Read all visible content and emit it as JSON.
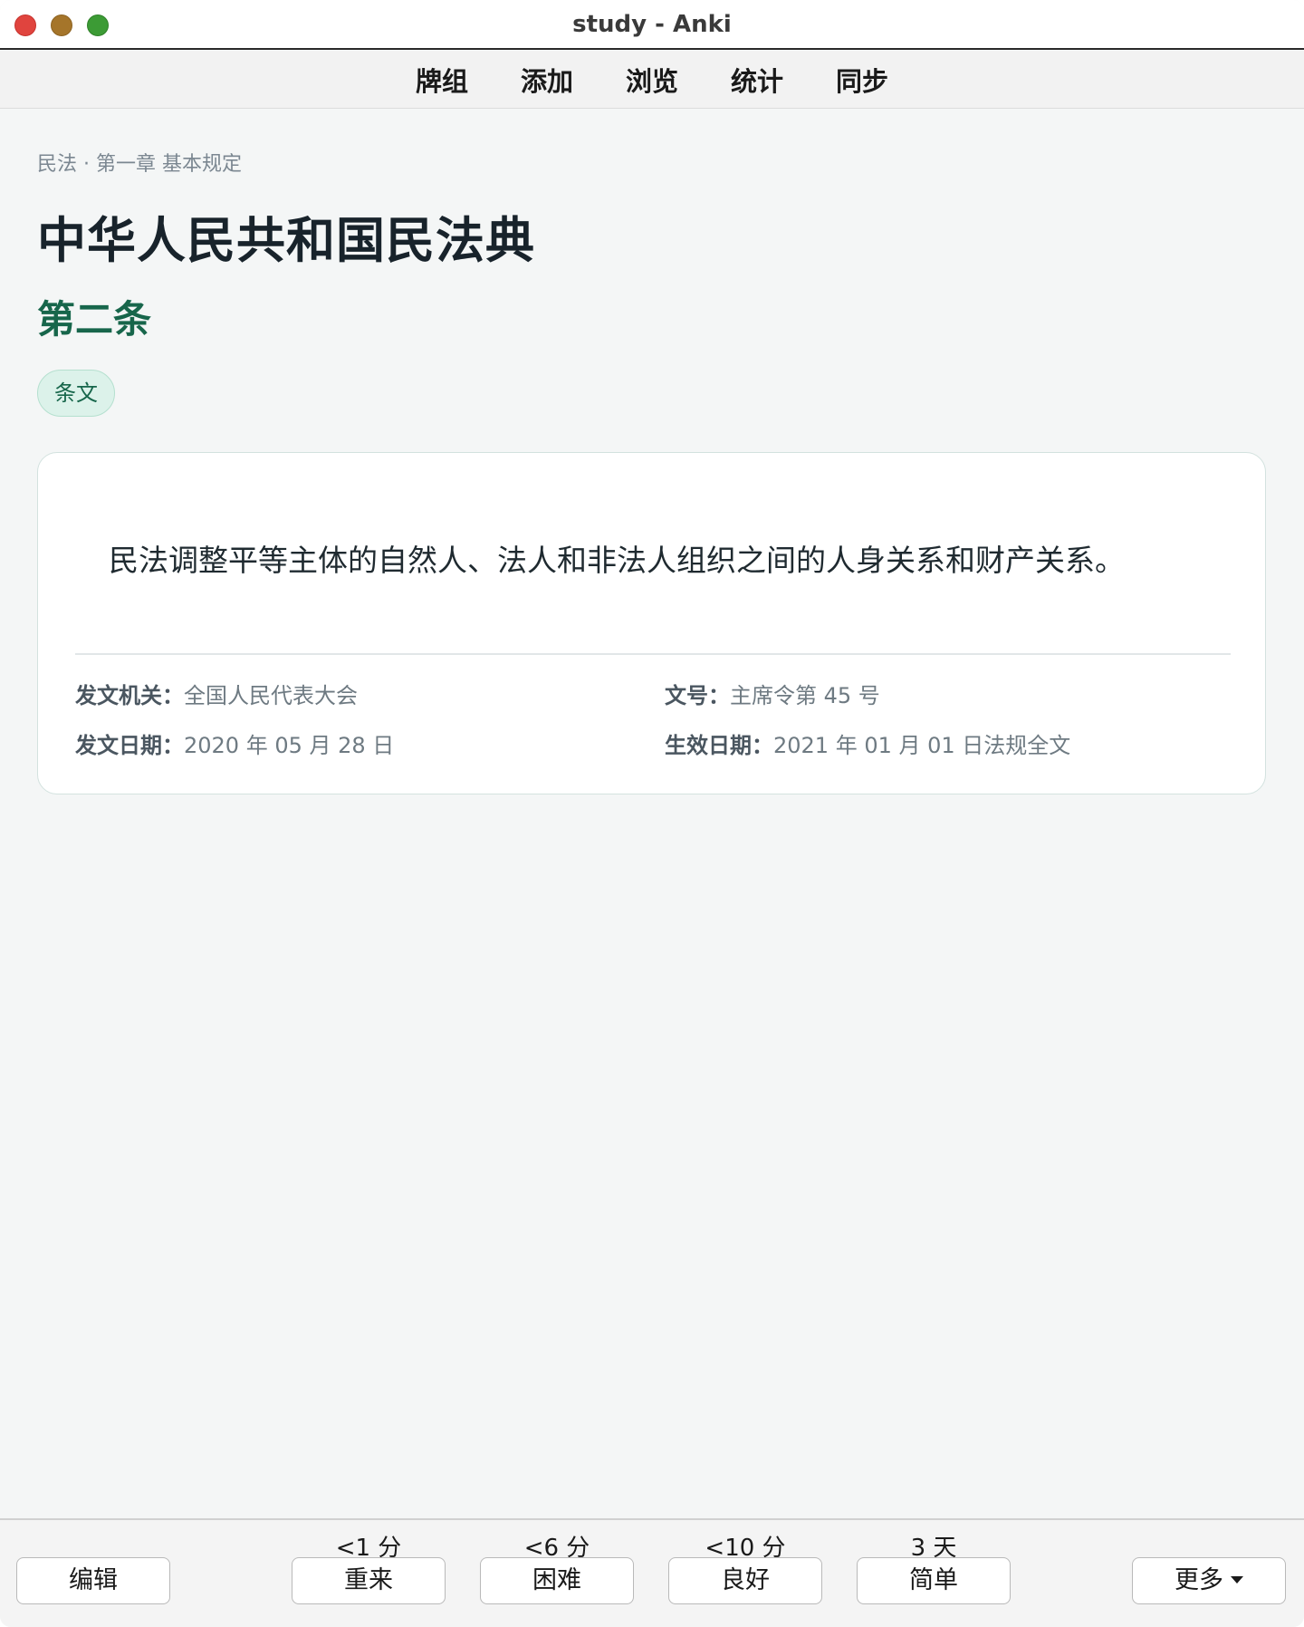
{
  "window": {
    "title": "study - Anki"
  },
  "nav": {
    "items": [
      "牌组",
      "添加",
      "浏览",
      "统计",
      "同步"
    ]
  },
  "card": {
    "breadcrumb": "民法 · 第一章 基本规定",
    "law_title": "中华人民共和国民法典",
    "article_number": "第二条",
    "tag": "条文",
    "text": "民法调整平等主体的自然人、法人和非法人组织之间的人身关系和财产关系。",
    "meta": {
      "issuer_label": "发文机关：",
      "issuer_value": "全国人民代表大会",
      "doc_no_label": "文号：",
      "doc_no_value": "主席令第 45 号",
      "issue_date_label": "发文日期：",
      "issue_date_value": "2020 年 05 月 28 日",
      "effective_date_label": "生效日期：",
      "effective_date_value": "2021 年 01 月 01 日法规全文"
    }
  },
  "bottom": {
    "edit_label": "编辑",
    "more_label": "更多",
    "answers": [
      {
        "interval": "<1 分",
        "label": "重来"
      },
      {
        "interval": "<6 分",
        "label": "困难"
      },
      {
        "interval": "<10 分",
        "label": "良好"
      },
      {
        "interval": "3 天",
        "label": "简单"
      }
    ]
  },
  "colors": {
    "accent_green": "#17664b",
    "tag_bg": "#dcf2ea",
    "traffic_close": "#e0443e",
    "traffic_min": "#a5752a",
    "traffic_max": "#3c9b35"
  }
}
